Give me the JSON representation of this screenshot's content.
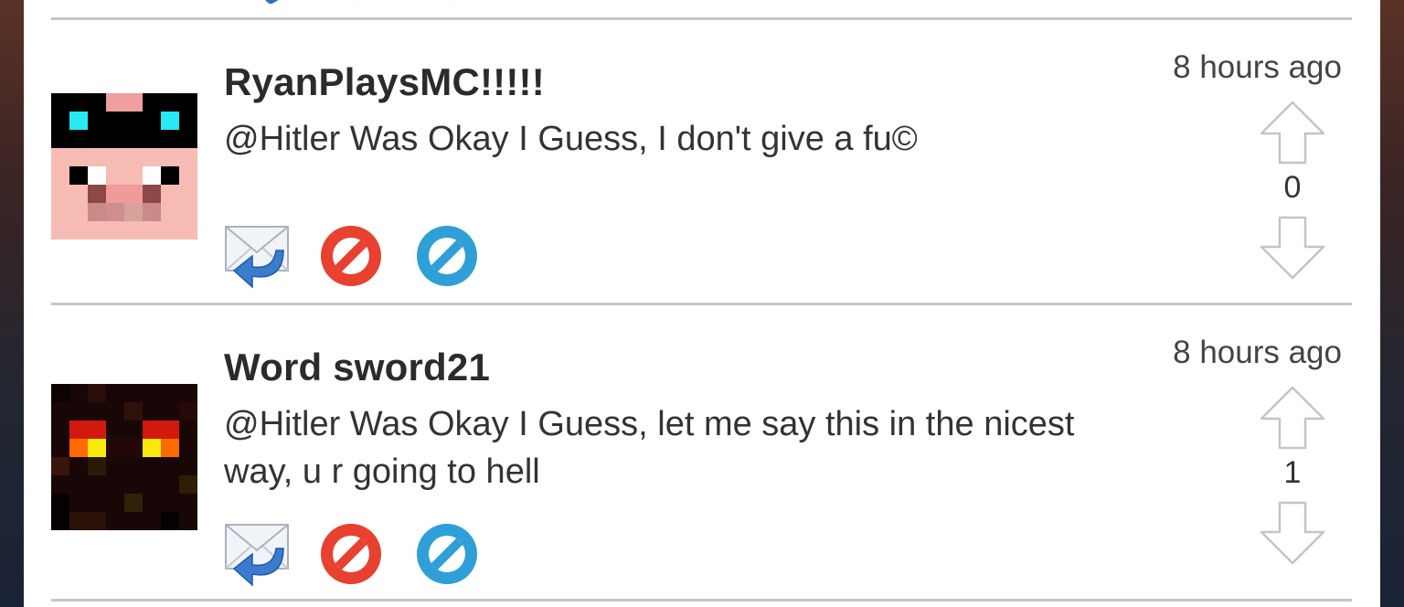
{
  "comments": [
    {
      "username": "RyanPlaysMC!!!!!",
      "text": "@Hitler Was Okay I Guess, I don't give a fu©",
      "time": "8 hours ago",
      "votes": "0",
      "avatar": "pig-face-with-sunglasses"
    },
    {
      "username": "Word sword21",
      "text": "@Hitler Was Okay I Guess, let me say this in the nicest way, u r going to hell",
      "time": "8 hours ago",
      "votes": "1",
      "avatar": "dark-red-creature-face"
    }
  ],
  "icons": {
    "reply": "reply-envelope-icon",
    "report": "report-block-icon",
    "block": "block-icon",
    "upvote": "upvote-arrow-icon",
    "downvote": "downvote-arrow-icon"
  },
  "colors": {
    "report_red": "#e8412f",
    "block_blue": "#2f9fd8",
    "divider": "#c6c6c6"
  }
}
